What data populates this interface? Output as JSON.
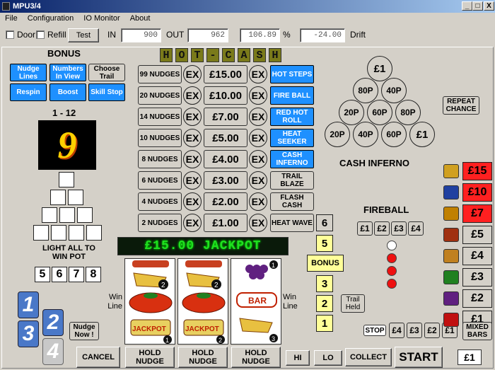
{
  "window": {
    "title": "MPU3/4",
    "min": "_",
    "max": "□",
    "close": "X"
  },
  "menu": [
    "File",
    "Configuration",
    "IO Monitor",
    "About"
  ],
  "toolbar": {
    "door": "Door",
    "refill": "Refill",
    "test": "Test",
    "in_label": "IN",
    "in_value": "900",
    "out_label": "OUT",
    "out_value": "962",
    "percent_value": "106.89",
    "percent_sign": "%",
    "drift_value": "-24.00",
    "drift_label": "Drift"
  },
  "bonus": {
    "title": "BONUS",
    "buttons": [
      "Nudge Lines",
      "Numbers In View",
      "Choose Trail",
      "Respin",
      "Boost",
      "Skill Stop"
    ],
    "range": "1 - 12",
    "digit": "9",
    "light_text": "LIGHT ALL TO WIN POT",
    "digits": [
      "5",
      "6",
      "7",
      "8"
    ]
  },
  "hotcash": {
    "letters": [
      "H",
      "O",
      "T",
      "-",
      "C",
      "A",
      "S",
      "H"
    ],
    "rows": [
      {
        "nudges": "99 NUDGES",
        "ex1": "EX",
        "amount": "£15.00",
        "ex2": "EX",
        "feature": "HOT STEPS",
        "blue": true
      },
      {
        "nudges": "20 NUDGES",
        "ex1": "EX",
        "amount": "£10.00",
        "ex2": "EX",
        "feature": "FIRE BALL",
        "blue": true
      },
      {
        "nudges": "14 NUDGES",
        "ex1": "EX",
        "amount": "£7.00",
        "ex2": "EX",
        "feature": "RED HOT ROLL",
        "blue": true
      },
      {
        "nudges": "10 NUDGES",
        "ex1": "EX",
        "amount": "£5.00",
        "ex2": "EX",
        "feature": "HEAT SEEKER",
        "blue": true
      },
      {
        "nudges": "8 NUDGES",
        "ex1": "EX",
        "amount": "£4.00",
        "ex2": "EX",
        "feature": "CASH INFERNO",
        "blue": true
      },
      {
        "nudges": "6 NUDGES",
        "ex1": "EX",
        "amount": "£3.00",
        "ex2": "EX",
        "feature": "TRAIL BLAZE",
        "blue": false
      },
      {
        "nudges": "4 NUDGES",
        "ex1": "EX",
        "amount": "£2.00",
        "ex2": "EX",
        "feature": "FLASH CASH",
        "blue": false
      },
      {
        "nudges": "2 NUDGES",
        "ex1": "EX",
        "amount": "£1.00",
        "ex2": "EX",
        "feature": "HEAT WAVE",
        "blue": false
      }
    ]
  },
  "led": "£15.00 JACKPOT",
  "trail": {
    "numbers": [
      "6",
      "5",
      "3",
      "2",
      "1"
    ],
    "bonus": "BONUS",
    "trail_held": "Trail Held"
  },
  "reels": {
    "win_line_left": "Win Line",
    "win_line_right": "Win Line"
  },
  "inferno": {
    "title": "CASH INFERNO",
    "rows": [
      [
        "£1"
      ],
      [
        "80P",
        "40P"
      ],
      [
        "20P",
        "60P",
        "80P"
      ],
      [
        "20P",
        "40P",
        "60P",
        "£1"
      ]
    ],
    "repeat": "REPEAT CHANCE"
  },
  "fireball": {
    "title": "FIREBALL",
    "values": [
      "£1",
      "£2",
      "£3",
      "£4"
    ]
  },
  "stop": {
    "label": "STOP",
    "values": [
      "£4",
      "£3",
      "£2",
      "£1"
    ]
  },
  "paytable": {
    "values": [
      "£15",
      "£10",
      "£7",
      "£5",
      "£4",
      "£3",
      "£2",
      "£1"
    ],
    "mixed": "MIXED BARS",
    "colors": [
      "#ff2020",
      "#ff2020",
      "#ff2020",
      "#d4d0c8",
      "#d4d0c8",
      "#d4d0c8",
      "#d4d0c8",
      "#d4d0c8"
    ]
  },
  "side": {
    "nudge_now": "Nudge Now !",
    "numbers": [
      "1",
      "2",
      "3",
      "4"
    ]
  },
  "bottom": {
    "cancel": "CANCEL",
    "hold1": "HOLD NUDGE",
    "hold2": "HOLD NUDGE",
    "hold3": "HOLD NUDGE",
    "hi": "HI",
    "lo": "LO",
    "collect": "COLLECT",
    "start": "START",
    "credit": "£1"
  }
}
